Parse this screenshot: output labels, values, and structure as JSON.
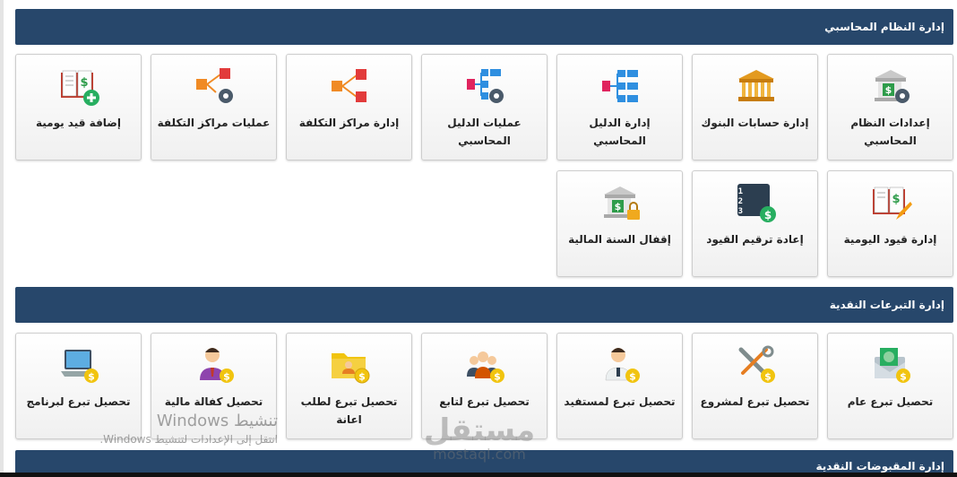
{
  "sections": [
    {
      "title": "إدارة النظام المحاسبي"
    },
    {
      "title": "إدارة التبرعات النقدية"
    },
    {
      "title": "إدارة المقبوضات النقدية"
    }
  ],
  "accounting_tiles": [
    {
      "label": "إعدادات النظام المحاسبي",
      "icon": "bank-settings-icon"
    },
    {
      "label": "إدارة حسابات البنوك",
      "icon": "bank-building-icon"
    },
    {
      "label": "إدارة الدليل المحاسبي",
      "icon": "chart-tree-icon"
    },
    {
      "label": "عمليات الدليل المحاسبي",
      "icon": "chart-tree-gear-icon"
    },
    {
      "label": "إدارة مراكز التكلفة",
      "icon": "cost-center-icon"
    },
    {
      "label": "عمليات مراكز التكلفة",
      "icon": "cost-center-gear-icon"
    },
    {
      "label": "إضافة قيد يومية",
      "icon": "journal-add-icon"
    },
    {
      "label": "إدارة قيود اليومية",
      "icon": "journal-edit-icon"
    },
    {
      "label": "إعادة ترقيم القيود",
      "icon": "renumber-icon"
    },
    {
      "label": "إقفال السنة المالية",
      "icon": "bank-lock-icon"
    }
  ],
  "donation_tiles": [
    {
      "label": "تحصيل تبرع عام",
      "icon": "money-envelope-icon"
    },
    {
      "label": "تحصيل تبرع لمشروع",
      "icon": "tools-coin-icon"
    },
    {
      "label": "تحصيل تبرع لمستفيد",
      "icon": "beneficiary-coin-icon"
    },
    {
      "label": "تحصيل تبرع لتابع",
      "icon": "group-coin-icon"
    },
    {
      "label": "تحصيل تبرع لطلب اعانة",
      "icon": "folder-coin-icon"
    },
    {
      "label": "تحصيل كفالة مالية",
      "icon": "sponsor-coin-icon"
    },
    {
      "label": "تحصيل تبرع لبرنامج",
      "icon": "laptop-coin-icon"
    }
  ],
  "watermarks": {
    "windows_title": "تنشيط Windows",
    "windows_sub": "انتقل إلى الإعدادات لتنشيط Windows.",
    "mostaql_ar": "مستقل",
    "mostaql_en": "mostaql.com"
  }
}
